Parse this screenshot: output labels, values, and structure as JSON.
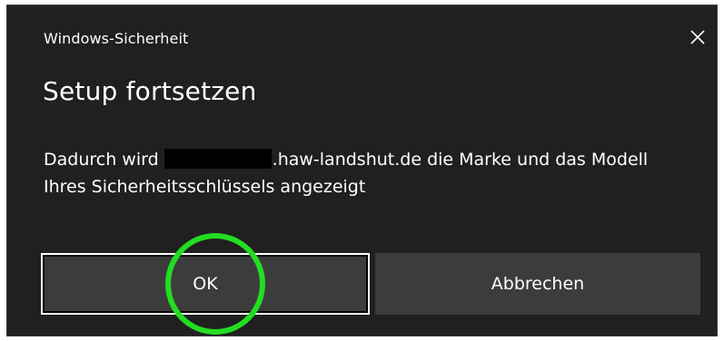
{
  "window": {
    "title": "Windows-Sicherheit"
  },
  "dialog": {
    "heading": "Setup fortsetzen",
    "message_before": "Dadurch wird",
    "message_after": ".haw-landshut.de die Marke und das Modell Ihres Sicherheitsschlüssels angezeigt"
  },
  "buttons": {
    "ok_label": "OK",
    "cancel_label": "Abbrechen"
  },
  "icons": {
    "close": "close-icon"
  },
  "colors": {
    "dialog_background": "#202020",
    "button_background": "#3c3c3c",
    "text": "#ffffff",
    "highlight": "#22dd22",
    "redaction": "#000000"
  }
}
